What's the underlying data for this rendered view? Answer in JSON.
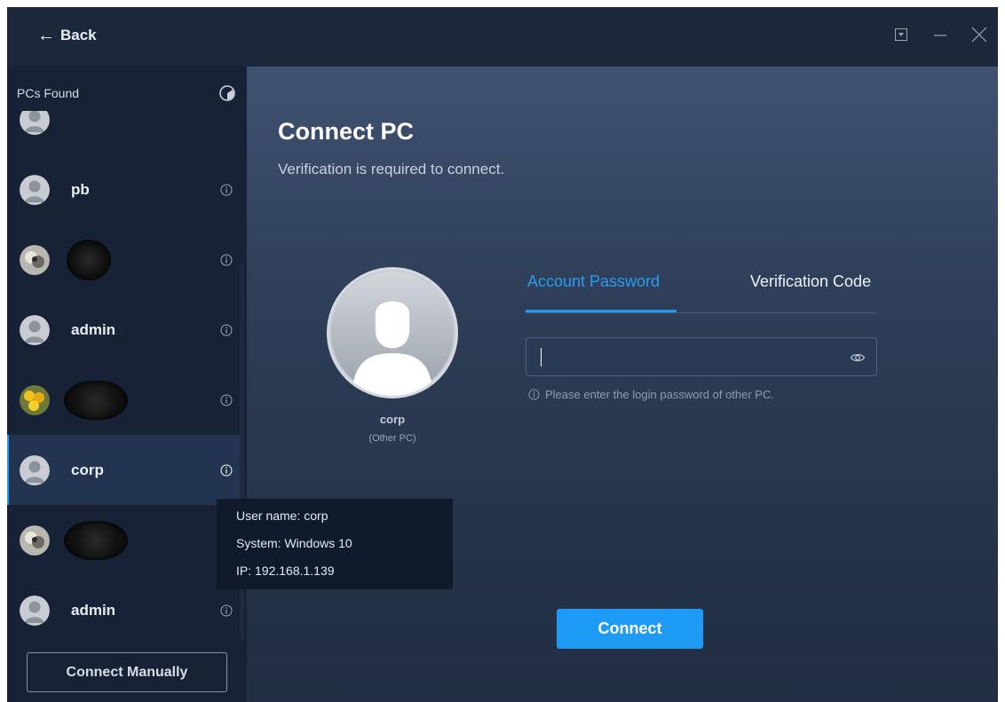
{
  "titlebar": {
    "back_label": "Back",
    "icons": [
      "arrow-left-icon",
      "dropdown-box-icon",
      "minimize-icon",
      "close-icon"
    ]
  },
  "sidebar": {
    "header_label": "PCs Found",
    "items": [
      {
        "name": "",
        "avatar": "default",
        "partial": true
      },
      {
        "name": "pb",
        "avatar": "default"
      },
      {
        "name": "",
        "avatar": "photo",
        "obscured": true
      },
      {
        "name": "admin",
        "avatar": "default"
      },
      {
        "name": "",
        "avatar": "photo-yellow",
        "obscured": true
      },
      {
        "name": "corp",
        "avatar": "default",
        "selected": true
      },
      {
        "name": "",
        "avatar": "photo",
        "obscured": true
      },
      {
        "name": "admin",
        "avatar": "default"
      }
    ],
    "connect_manually_label": "Connect Manually"
  },
  "main": {
    "title": "Connect PC",
    "subtitle": "Verification is required to connect.",
    "target": {
      "name": "corp",
      "type": "(Other PC)"
    },
    "tabs": [
      {
        "label": "Account Password",
        "active": true
      },
      {
        "label": "Verification Code",
        "active": false
      }
    ],
    "password": {
      "value": "",
      "placeholder": ""
    },
    "hint": "Please enter the login password of other PC.",
    "connect_label": "Connect"
  },
  "tooltip": {
    "username": "User name: corp",
    "system": "System: Windows 10",
    "ip": "IP: 192.168.1.139"
  },
  "colors": {
    "accent": "#1e9bf5",
    "sidebar_bg": "#172236",
    "selected_bg": "#233450",
    "titlebar_bg": "#1b283c"
  }
}
